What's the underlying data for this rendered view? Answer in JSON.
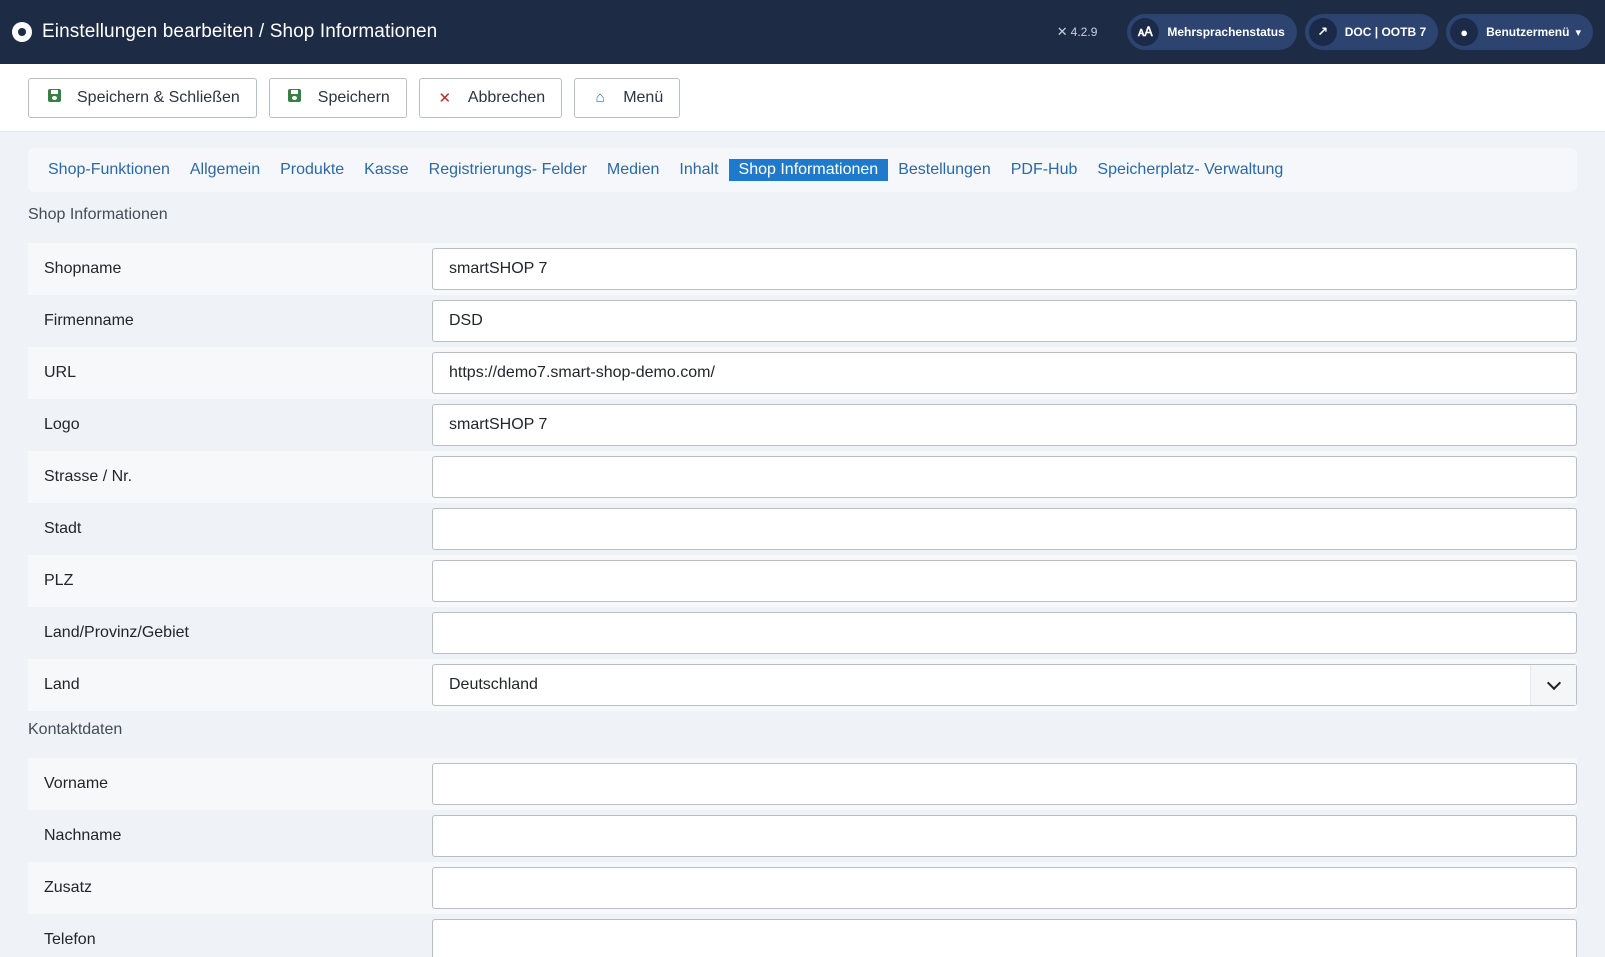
{
  "header": {
    "title": "Einstellungen bearbeiten / Shop Informationen",
    "version": "4.2.9",
    "multilang_label": "Mehrsprachenstatus",
    "doc_label": "DOC | OOTB 7",
    "user_menu_label": "Benutzermenü"
  },
  "toolbar": {
    "save_close_label": "Speichern & Schließen",
    "save_label": "Speichern",
    "cancel_label": "Abbrechen",
    "menu_label": "Menü"
  },
  "tabs": [
    {
      "label": "Shop-Funktionen"
    },
    {
      "label": "Allgemein"
    },
    {
      "label": "Produkte"
    },
    {
      "label": "Kasse"
    },
    {
      "label": "Registrierungs- Felder"
    },
    {
      "label": "Medien"
    },
    {
      "label": "Inhalt"
    },
    {
      "label": "Shop Informationen",
      "active": true
    },
    {
      "label": "Bestellungen"
    },
    {
      "label": "PDF-Hub"
    },
    {
      "label": "Speicherplatz- Verwaltung"
    }
  ],
  "shop_info": {
    "heading": "Shop Informationen",
    "shopname": {
      "label": "Shopname",
      "value": "smartSHOP 7"
    },
    "firmenname": {
      "label": "Firmenname",
      "value": "DSD"
    },
    "url": {
      "label": "URL",
      "value": "https://demo7.smart-shop-demo.com/"
    },
    "logo": {
      "label": "Logo",
      "value": "smartSHOP 7"
    },
    "strasse": {
      "label": "Strasse / Nr.",
      "value": ""
    },
    "stadt": {
      "label": "Stadt",
      "value": ""
    },
    "plz": {
      "label": "PLZ",
      "value": ""
    },
    "provinz": {
      "label": "Land/Provinz/Gebiet",
      "value": ""
    },
    "land": {
      "label": "Land",
      "value": "Deutschland"
    }
  },
  "contact": {
    "heading": "Kontaktdaten",
    "vorname": {
      "label": "Vorname",
      "value": ""
    },
    "nachname": {
      "label": "Nachname",
      "value": ""
    },
    "zusatz": {
      "label": "Zusatz",
      "value": ""
    },
    "telefon": {
      "label": "Telefon",
      "value": ""
    }
  },
  "colors": {
    "header_bg": "#1e2b45",
    "active_tab": "#1f7acb",
    "link": "#2a69a8"
  }
}
